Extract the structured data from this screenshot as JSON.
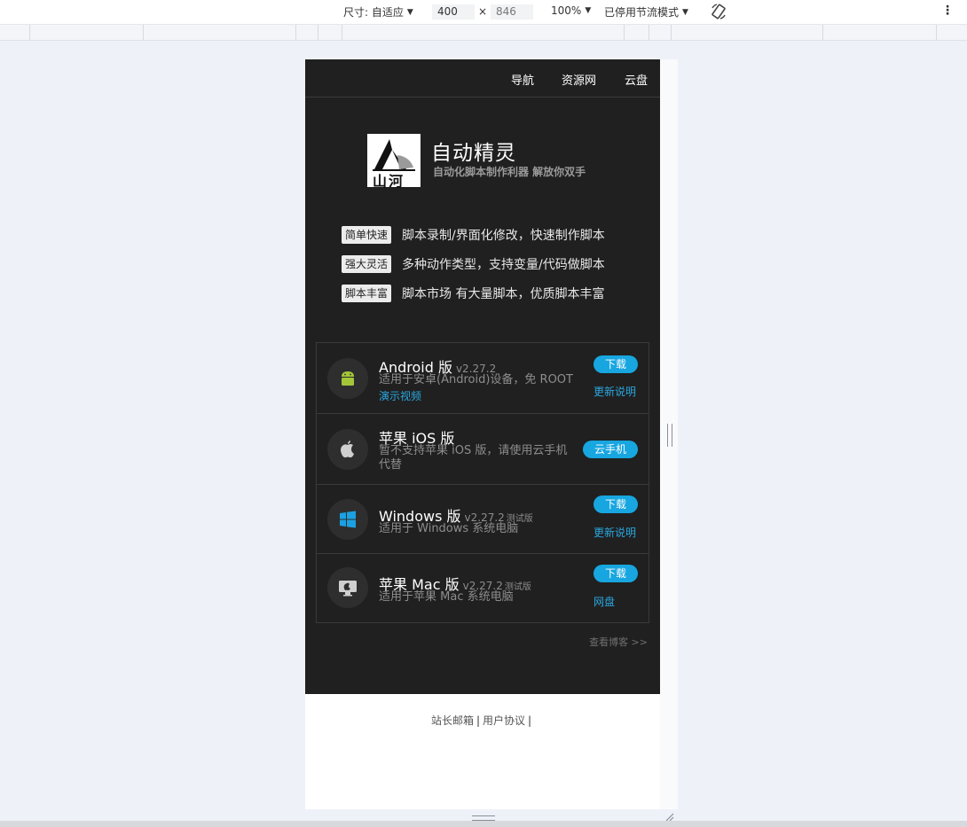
{
  "devtools": {
    "size_label": "尺寸: 自适应",
    "width_value": "400",
    "times": "×",
    "height_value": "846",
    "zoom": "100%",
    "throttle": "已停用节流模式"
  },
  "nav": {
    "items": [
      "导航",
      "资源网",
      "云盘"
    ]
  },
  "brand": {
    "logo_text": "山河",
    "title": "自动精灵",
    "subtitle": "自动化脚本制作利器 解放你双手"
  },
  "features": [
    {
      "tag": "简单快速",
      "text": "脚本录制/界面化修改，快速制作脚本"
    },
    {
      "tag": "强大灵活",
      "text": "多种动作类型，支持变量/代码做脚本"
    },
    {
      "tag": "脚本丰富",
      "text": "脚本市场 有大量脚本，优质脚本丰富"
    }
  ],
  "downloads": [
    {
      "name": "Android 版",
      "version": "v2.27.2",
      "beta": "",
      "desc": "适用于安卓(Android)设备，免 ROOT",
      "link": "演示视频",
      "button": "下载",
      "notes": "更新说明",
      "icon": "android-icon"
    },
    {
      "name": "苹果 iOS 版",
      "version": "",
      "beta": "",
      "desc": "暂不支持苹果 iOS 版，请使用云手机代替",
      "link": "",
      "button": "云手机",
      "notes": "",
      "icon": "apple-icon"
    },
    {
      "name": "Windows 版",
      "version": "v2.27.2",
      "beta": "测试版",
      "desc": "适用于 Windows 系统电脑",
      "link": "",
      "button": "下载",
      "notes": "更新说明",
      "icon": "windows-icon"
    },
    {
      "name": "苹果 Mac 版",
      "version": "v2.27.2",
      "beta": "测试版",
      "desc": "适用于苹果 Mac 系统电脑",
      "link": "",
      "button": "下载",
      "notes": "网盘",
      "icon": "mac-icon"
    }
  ],
  "blog_link": "查看博客 >>",
  "footer": {
    "email": "站长邮箱",
    "sep": "|",
    "agreement": "用户协议"
  },
  "colors": {
    "dark_bg": "#202020",
    "accent": "#17a6e0",
    "android_green": "#a4c639",
    "windows_blue": "#1ba1e2"
  }
}
